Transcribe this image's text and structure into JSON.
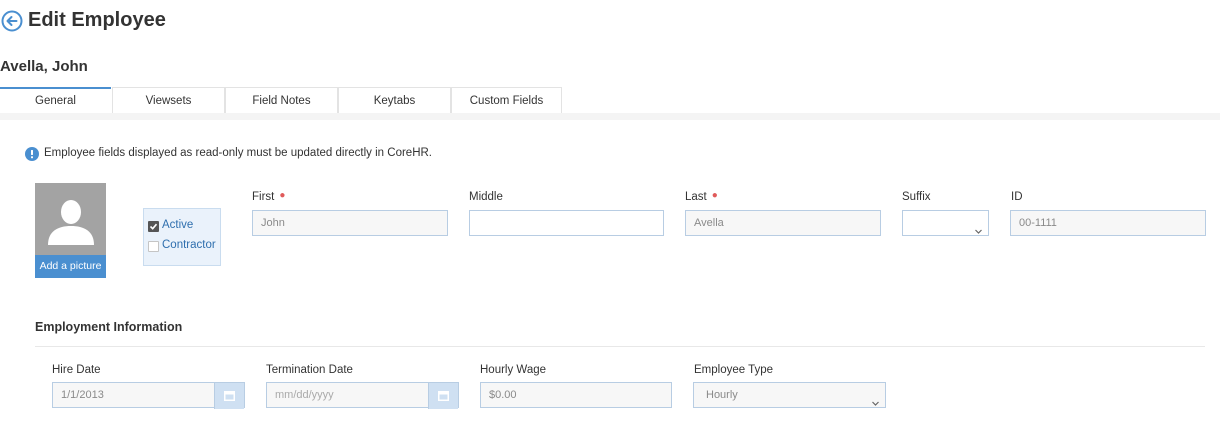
{
  "header": {
    "title": "Edit Employee"
  },
  "employee": {
    "display_name": "Avella, John"
  },
  "tabs": [
    {
      "label": "General",
      "active": true
    },
    {
      "label": "Viewsets",
      "active": false
    },
    {
      "label": "Field Notes",
      "active": false
    },
    {
      "label": "Keytabs",
      "active": false
    },
    {
      "label": "Custom Fields",
      "active": false
    }
  ],
  "notice": {
    "text": "Employee fields displayed as read-only must be updated directly in CoreHR."
  },
  "avatar": {
    "add_label": "Add a picture"
  },
  "status": {
    "active": {
      "label": "Active",
      "checked": true
    },
    "contractor": {
      "label": "Contractor",
      "checked": false
    }
  },
  "name_fields": {
    "first": {
      "label": "First",
      "value": "John",
      "required": true
    },
    "middle": {
      "label": "Middle",
      "value": ""
    },
    "last": {
      "label": "Last",
      "value": "Avella",
      "required": true
    },
    "suffix": {
      "label": "Suffix",
      "value": ""
    },
    "id": {
      "label": "ID",
      "value": "00-1111"
    }
  },
  "employment": {
    "title": "Employment Information",
    "hire_date": {
      "label": "Hire Date",
      "value": "1/1/2013"
    },
    "termination_date": {
      "label": "Termination Date",
      "placeholder": "mm/dd/yyyy"
    },
    "hourly_wage": {
      "label": "Hourly Wage",
      "value": "$0.00"
    },
    "employee_type": {
      "label": "Employee Type",
      "value": "Hourly"
    }
  },
  "colors": {
    "accent": "#4a8fd0",
    "required": "#e05a5a",
    "input_border": "#b8cde3"
  }
}
